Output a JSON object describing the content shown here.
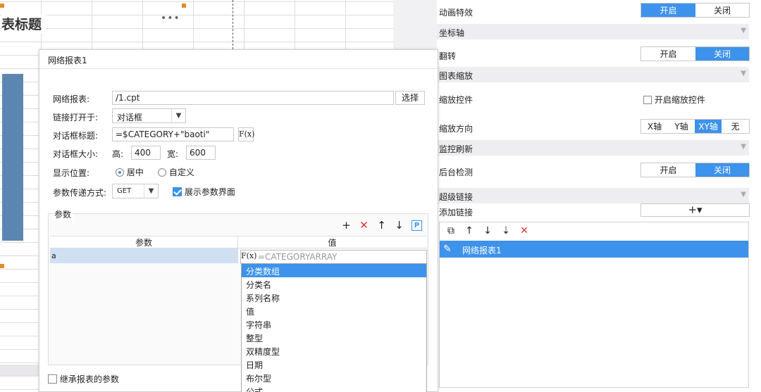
{
  "sheet": {
    "title": "表标题",
    "menu_dots": "•••"
  },
  "right_panel": {
    "animation": {
      "label": "动画特效",
      "options": [
        "开启",
        "关闭"
      ],
      "selected": 0
    },
    "axis_section": "坐标轴",
    "flip": {
      "label": "翻转",
      "options": [
        "开启",
        "关闭"
      ],
      "selected": 1
    },
    "zoom_section": "图表缩放",
    "zoom_control": {
      "label": "缩放控件",
      "checkbox_label": "开启缩放控件"
    },
    "zoom_direction": {
      "label": "缩放方向",
      "options": [
        "X轴",
        "Y轴",
        "XY轴",
        "无"
      ],
      "selected": 2
    },
    "monitor_section": "监控刷新",
    "background_check": {
      "label": "后台检测",
      "options": [
        "开启",
        "关闭"
      ],
      "selected": 1
    },
    "hyperlink_section": "超级链接",
    "add_link": {
      "label": "添加链接",
      "button": "+▾"
    },
    "link_tools": [
      "⧉",
      "↑",
      "↓",
      "⇣",
      "✕"
    ],
    "link_items": [
      "网络报表1"
    ]
  },
  "dialog": {
    "title": "网络报表1",
    "report": {
      "label": "网络报表:",
      "value": "/1.cpt",
      "button": "选择"
    },
    "open_in": {
      "label": "链接打开于:",
      "value": "对话框"
    },
    "dialog_title": {
      "label": "对话框标题:",
      "value": "=$CATEGORY+\"baoti\"",
      "fx": "F(x)"
    },
    "dialog_size": {
      "label": "对话框大小:",
      "height_label": "高:",
      "height": "400",
      "width_label": "宽:",
      "width": "600"
    },
    "position": {
      "label": "显示位置:",
      "options": [
        "居中",
        "自定义"
      ],
      "selected": 0
    },
    "pass_method": {
      "label": "参数传递方式:",
      "value": "GET",
      "show_params_label": "展示参数界面"
    },
    "params": {
      "legend": "参数",
      "tools": [
        "+",
        "✕",
        "↑",
        "↓",
        "P"
      ],
      "col_param": "参数",
      "col_value": "值",
      "rows": [
        {
          "name": "a",
          "value": "=CATEGORYARRAY"
        }
      ],
      "fx": "F(x)"
    },
    "dropdown": {
      "options": [
        "分类数组",
        "分类名",
        "系列名称",
        "值",
        "字符串",
        "整型",
        "双精度型",
        "日期",
        "布尔型",
        "公式"
      ],
      "selected": 0
    },
    "inherit_label": "继承报表的参数"
  },
  "colors": {
    "accent": "#3d92eb",
    "section_bg": "#eeedf1",
    "chart_bar": "#5b86b1"
  }
}
